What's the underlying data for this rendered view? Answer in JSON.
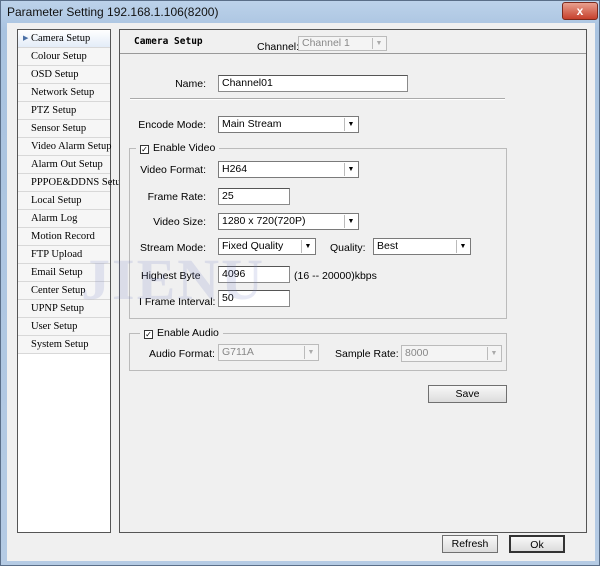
{
  "window": {
    "title": "Parameter Setting 192.168.1.106(8200)",
    "close": "x"
  },
  "sidebar": {
    "items": [
      {
        "label": "Camera Setup",
        "active": true
      },
      {
        "label": "Colour Setup"
      },
      {
        "label": "OSD Setup"
      },
      {
        "label": "Network Setup"
      },
      {
        "label": "PTZ Setup"
      },
      {
        "label": "Sensor Setup"
      },
      {
        "label": "Video Alarm Setup"
      },
      {
        "label": "Alarm Out Setup"
      },
      {
        "label": "PPPOE&DDNS Setup"
      },
      {
        "label": "Local Setup"
      },
      {
        "label": "Alarm Log"
      },
      {
        "label": "Motion Record"
      },
      {
        "label": "FTP Upload"
      },
      {
        "label": "Email Setup"
      },
      {
        "label": "Center Setup"
      },
      {
        "label": "UPNP Setup"
      },
      {
        "label": "User Setup"
      },
      {
        "label": "System Setup"
      }
    ]
  },
  "main": {
    "heading": "Camera Setup",
    "channel_label": "Channel:",
    "channel_value": "Channel 1",
    "name_label": "Name:",
    "name_value": "Channel01",
    "encode_label": "Encode Mode:",
    "encode_value": "Main Stream",
    "video": {
      "legend": "Enable Video",
      "enabled": true,
      "format_label": "Video Format:",
      "format_value": "H264",
      "frame_label": "Frame Rate:",
      "frame_value": "25",
      "size_label": "Video Size:",
      "size_value": "1280 x 720(720P)",
      "stream_label": "Stream Mode:",
      "stream_value": "Fixed Quality",
      "quality_label": "Quality:",
      "quality_value": "Best",
      "byte_label": "Highest Byte",
      "byte_value": "4096",
      "byte_range": "(16 -- 20000)kbps",
      "iframe_label": "I Frame Interval:",
      "iframe_value": "50"
    },
    "audio": {
      "legend": "Enable Audio",
      "enabled": true,
      "format_label": "Audio Format:",
      "format_value": "G711A",
      "rate_label": "Sample Rate:",
      "rate_value": "8000"
    },
    "save": "Save"
  },
  "footer": {
    "refresh": "Refresh",
    "ok": "Ok"
  },
  "watermark": "JIENU"
}
